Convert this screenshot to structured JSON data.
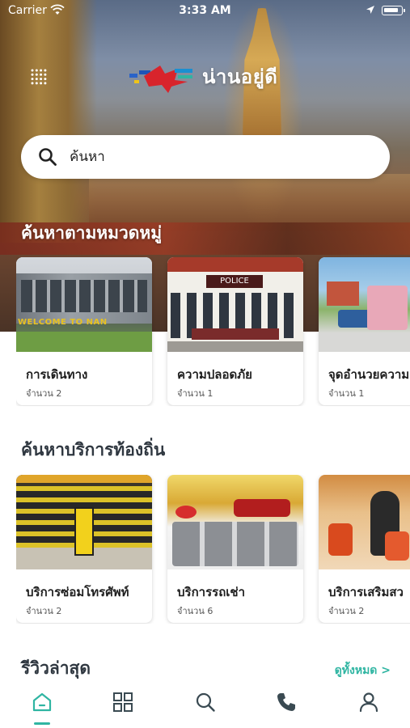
{
  "status_bar": {
    "carrier": "Carrier",
    "time": "3:33 AM"
  },
  "header": {
    "app_name": "น่านอยู่ดี",
    "menu_icon": "dots-grid-icon",
    "logo": "app-logo"
  },
  "search": {
    "placeholder": "ค้นหา",
    "icon": "search-icon"
  },
  "categories": {
    "title": "ค้นหาตามหมวดหมู่",
    "items": [
      {
        "label": "การเดินทาง",
        "count": "จำนวน 2"
      },
      {
        "label": "ความปลอดภัย",
        "count": "จำนวน 1"
      },
      {
        "label": "จุดอำนวยความ",
        "count": "จำนวน 1"
      }
    ]
  },
  "local_services": {
    "title": "ค้นหาบริการท้องถิ่น",
    "items": [
      {
        "label": "บริการซ่อมโทรศัพท์",
        "count": "จำนวน 2"
      },
      {
        "label": "บริการรถเช่า",
        "count": "จำนวน 6"
      },
      {
        "label": "บริการเสริมสว",
        "count": "จำนวน 2"
      }
    ]
  },
  "reviews": {
    "title": "รีวิวล่าสุด",
    "see_all": "ดูทั้งหมด >"
  },
  "tab_bar": {
    "active": "home",
    "tabs": [
      "home-icon",
      "grid-icon",
      "search-icon",
      "phone-icon",
      "profile-icon"
    ]
  },
  "colors": {
    "accent": "#2fb5a2",
    "heading": "#2f3740",
    "tab_icon": "#3a4a52"
  }
}
